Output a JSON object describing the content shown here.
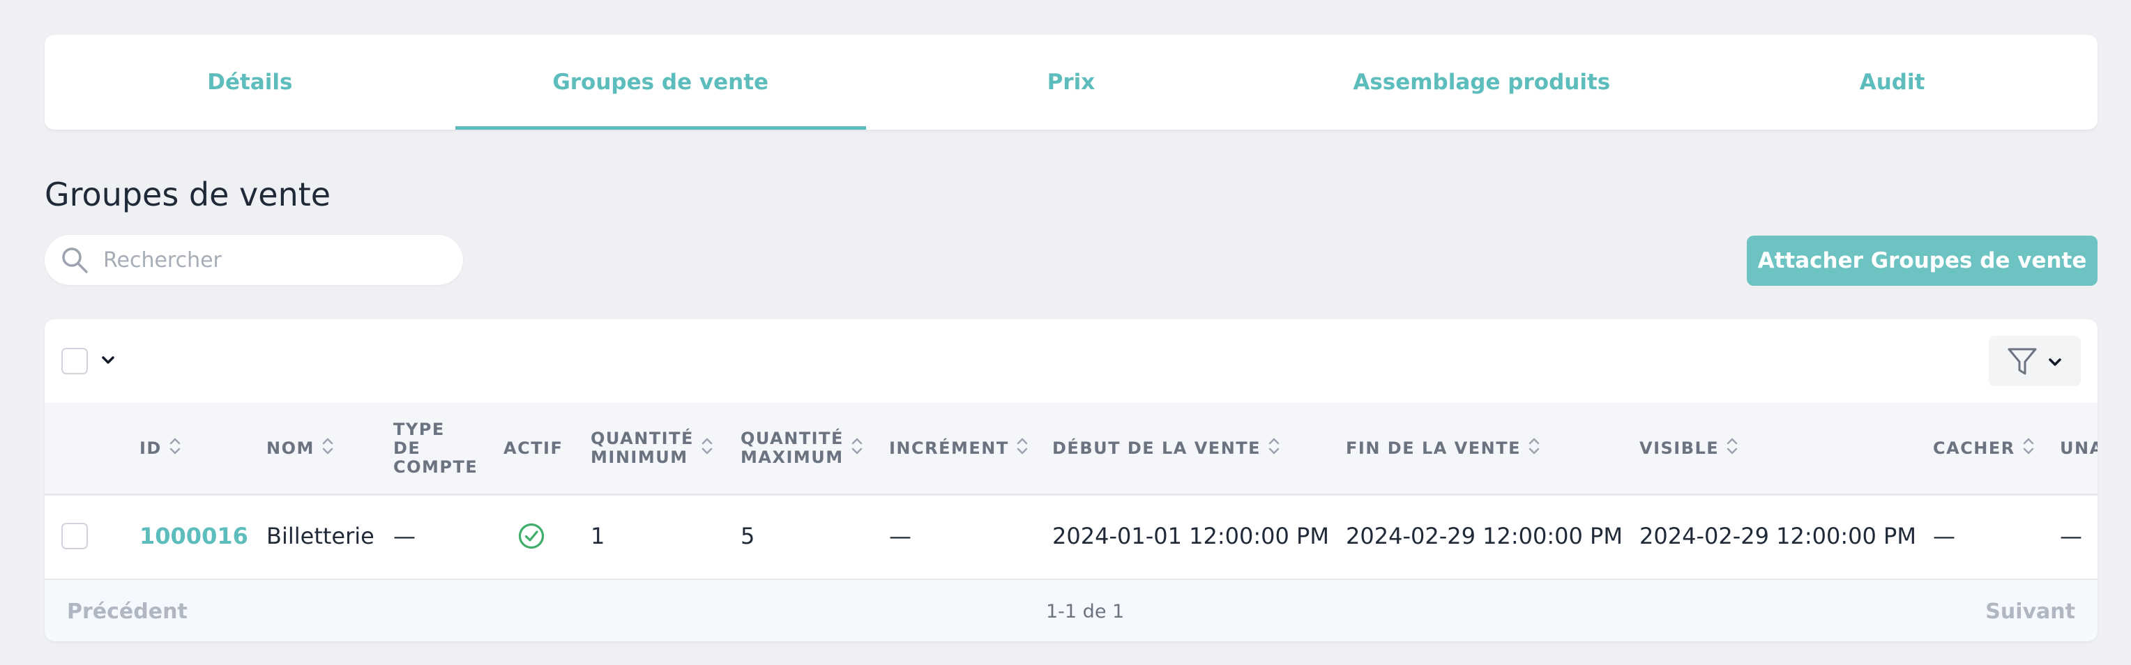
{
  "tabs": [
    {
      "label": "Détails"
    },
    {
      "label": "Groupes de vente",
      "active": true
    },
    {
      "label": "Prix"
    },
    {
      "label": "Assemblage produits"
    },
    {
      "label": "Audit"
    }
  ],
  "section": {
    "title": "Groupes de vente",
    "search_placeholder": "Rechercher",
    "attach_button": "Attacher Groupes de vente"
  },
  "table": {
    "columns": [
      {
        "key": "id",
        "label": "ID",
        "sortable": true
      },
      {
        "key": "nom",
        "label": "NOM",
        "sortable": true
      },
      {
        "key": "type",
        "label": "TYPE\nDE\nCOMPTE",
        "sortable": false
      },
      {
        "key": "actif",
        "label": "ACTIF",
        "sortable": false
      },
      {
        "key": "qmin",
        "label": "QUANTITÉ\nMINIMUM",
        "sortable": true
      },
      {
        "key": "qmax",
        "label": "QUANTITÉ\nMAXIMUM",
        "sortable": true
      },
      {
        "key": "incr",
        "label": "INCRÉMENT",
        "sortable": true
      },
      {
        "key": "debut",
        "label": "DÉBUT DE LA VENTE",
        "sortable": true
      },
      {
        "key": "fin",
        "label": "FIN DE LA VENTE",
        "sortable": true
      },
      {
        "key": "visible",
        "label": "VISIBLE",
        "sortable": true
      },
      {
        "key": "cacher",
        "label": "CACHER",
        "sortable": true
      },
      {
        "key": "una",
        "label": "UNA",
        "sortable": false
      }
    ],
    "rows": [
      {
        "id": "1000016",
        "nom": "Billetterie",
        "type": "—",
        "actif": "check-circle-icon",
        "qmin": "1",
        "qmax": "5",
        "incr": "—",
        "debut": "2024-01-01 12:00:00 PM",
        "fin": "2024-02-29 12:00:00 PM",
        "visible": "2024-02-29 12:00:00 PM",
        "cacher": "—",
        "una": "—"
      }
    ]
  },
  "pagination": {
    "previous": "Précédent",
    "info": "1-1 de 1",
    "next": "Suivant"
  },
  "colors": {
    "accent": "#5dbdbd",
    "button": "#6dc2c2",
    "background": "#eff0f4",
    "active_check": "#3fae6a"
  }
}
